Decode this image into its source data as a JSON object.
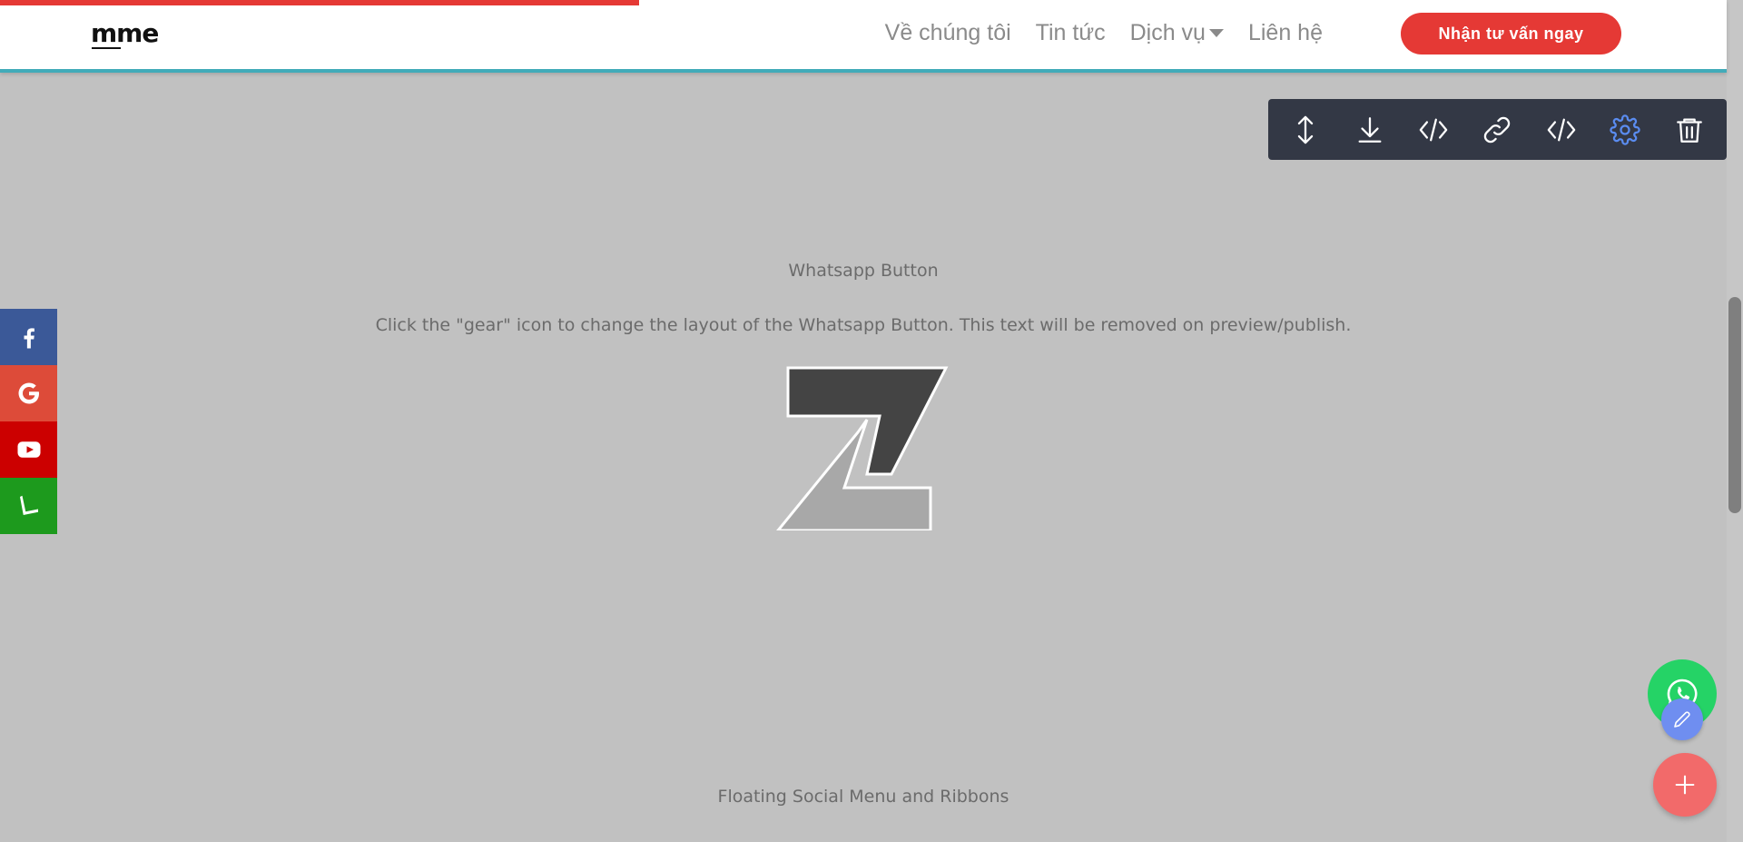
{
  "header": {
    "logo": "mme",
    "nav": [
      {
        "label": "Về chúng tôi"
      },
      {
        "label": "Tin tức"
      },
      {
        "label": "Dịch vụ"
      },
      {
        "label": "Liên hệ"
      }
    ],
    "cta_label": "Nhận tư vấn ngay"
  },
  "page_progress": 0.37,
  "toolbar": {
    "icons": [
      "move-updown-icon",
      "download-icon",
      "code-icon",
      "link-icon",
      "html-code-icon",
      "gear-icon",
      "trash-icon"
    ],
    "active_icon": "gear-icon"
  },
  "content": {
    "section_title": "Whatsapp Button",
    "instruction": "Click the \"gear\" icon to change the layout of the Whatsapp Button. This text will be removed on preview/publish.",
    "next_section_title": "Floating Social Menu and Ribbons"
  },
  "social": [
    {
      "name": "facebook",
      "color": "#3b5998"
    },
    {
      "name": "google",
      "color": "#dd4b39"
    },
    {
      "name": "youtube",
      "color": "#cc0000"
    },
    {
      "name": "line",
      "color": "#1d9a1d"
    }
  ],
  "colors": {
    "accent_red": "#e53935",
    "header_border": "#41abb9",
    "toolbar_bg": "#333845",
    "gear_active": "#5a8cf0",
    "whatsapp": "#25d366"
  }
}
